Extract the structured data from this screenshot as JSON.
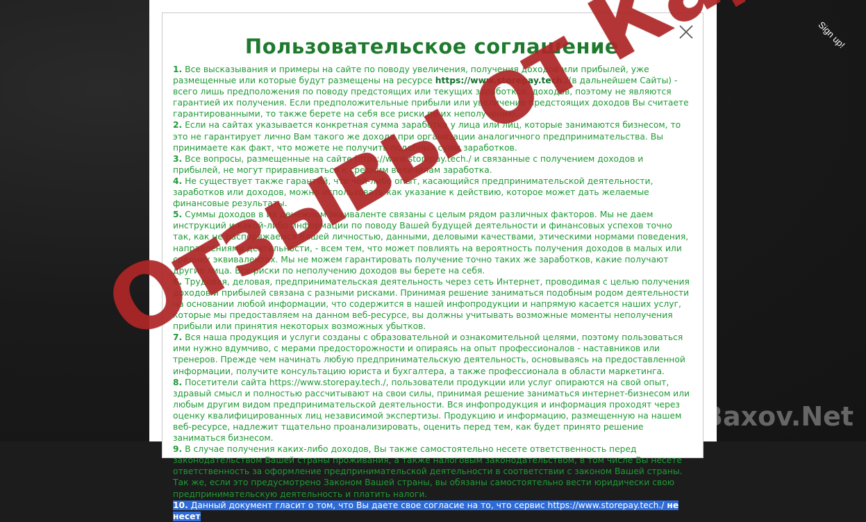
{
  "modal": {
    "title": "Пользовательское соглашение",
    "close_label": "×"
  },
  "signup_label": "Sign up!",
  "agreement": [
    {
      "num": "1.",
      "text_a": " Все высказывания и примеры на сайте по поводу увеличения, получения доходов или прибылей, уже размещенные или которые будут размещены на ресурсе ",
      "url": "https://www.storepay.tech.",
      "text_b": "/(в дальнейшем Сайты) - всего лишь предположения по поводу предстоящих или текущих заработков, доходов, поэтому не являются гарантией их получения. Если предположительные прибыли или увеличение предстоящих доходов Вы считаете гарантированными, то также берете на себя все риски по их неполучению."
    },
    {
      "num": "2.",
      "text": " Если на сайтах указывается конкретная сумма заработка у лица или лиц, которые занимаются бизнесом, то это не гарантирует лично Вам такого же дохода при организации аналогичного предпринимательства. Вы принимаете как факт, что можете не получить подобных сумм заработков."
    },
    {
      "num": "3.",
      "text": " Все вопросы, размещенные на сайте https://www.storepay.tech./ и связанные с получением доходов и прибылей, не могут приравниваться к средним величинам заработка."
    },
    {
      "num": "4.",
      "text": " Не существует также гарантий, что чей-либо опыт, касающийся предпринимательской деятельности, заработков или доходов, можно использовать как указание к действию, которое может дать желаемые финансовые результаты."
    },
    {
      "num": "5.",
      "text": " Суммы доходов в их денежном эквиваленте связаны с целым рядом различных факторов. Мы не даем инструкций и какой-либо информации по поводу Вашей будущей деятельности и финансовых успехов точно так, как не распоряжаемся Вашей личностью, данными, деловыми качествами, этическими нормами поведения, направлениями деятельности, - всем тем, что может повлиять на вероятность получения доходов в малых или средних эквивалентах. Мы не можем гарантировать получение точно таких же заработков, какие получают другие лица. Все риски по неполучению доходов вы берете на себя."
    },
    {
      "num": "6.",
      "text": " Трудовая, деловая, предпринимательская деятельность через сеть Интернет, проводимая с целью получения доходов и прибылей связана с разными рисками. Принимая решение заниматься подобным родом деятельности на основании любой информации, что содержится в нашей инфопродукции и напрямую касается наших услуг, которые мы предоставляем на данном веб-ресурсе, вы должны учитывать возможные моменты неполучения прибыли или принятия некоторых возможных убытков."
    },
    {
      "num": "7.",
      "text": " Вся наша продукция и услуги созданы с образовательной и ознакомительной целями, поэтому пользоваться ими нужно вдумчиво, с мерами предосторожности и опираясь на опыт профессионалов - наставников или тренеров. Прежде чем начинать любую предпринимательскую деятельность, основываясь на предоставленной информации, получите консультацию юриста и бухгалтера, а также профессионала в области маркетинга."
    },
    {
      "num": "8.",
      "text": " Посетители сайта https://www.storepay.tech./, пользователи продукции или услуг опираются на свой опыт, здравый смысл и полностью рассчитывают на свои силы, принимая решение заниматься интернет-бизнесом или любым другим видом предпринимательской деятельности. Вся инфопродукция и информация проходят через оценку квалифицированных лиц независимой экспертизы. Продукцию и информацию, размещенную на нашем веб-ресурсе, надлежит тщательно проанализировать, оценить перед тем, как будет принято решение заниматься бизнесом."
    },
    {
      "num": "9.",
      "text": " В случае получения каких-либо доходов, Вы также самостоятельно несете ответственность перед законодательством Вашей страны проживания, а также налоговым законодательством, в том числе Вы несете ответственность за оформление предпринимательской деятельности в соответствии с законом Вашей страны. Так же, если это предусмотрено Законом Вашей страны, вы обязаны самостоятельно вести юридически свою предпринимательскую деятельность и платить налоги."
    }
  ],
  "item10": {
    "num": "10.",
    "text": " Данный документ гласит о том, что Вы даете свое согласие на то, что сервис https://www.storepay.tech./ ",
    "bold": "не несет"
  },
  "watermark_text": "Отзывы от Кадосаности",
  "brand_text": "Baxov.Net",
  "colors": {
    "title_green": "#1f7a2e",
    "text_green": "#1f9a35",
    "selection_blue": "#2e6bd6",
    "watermark_red": "#b42828"
  }
}
